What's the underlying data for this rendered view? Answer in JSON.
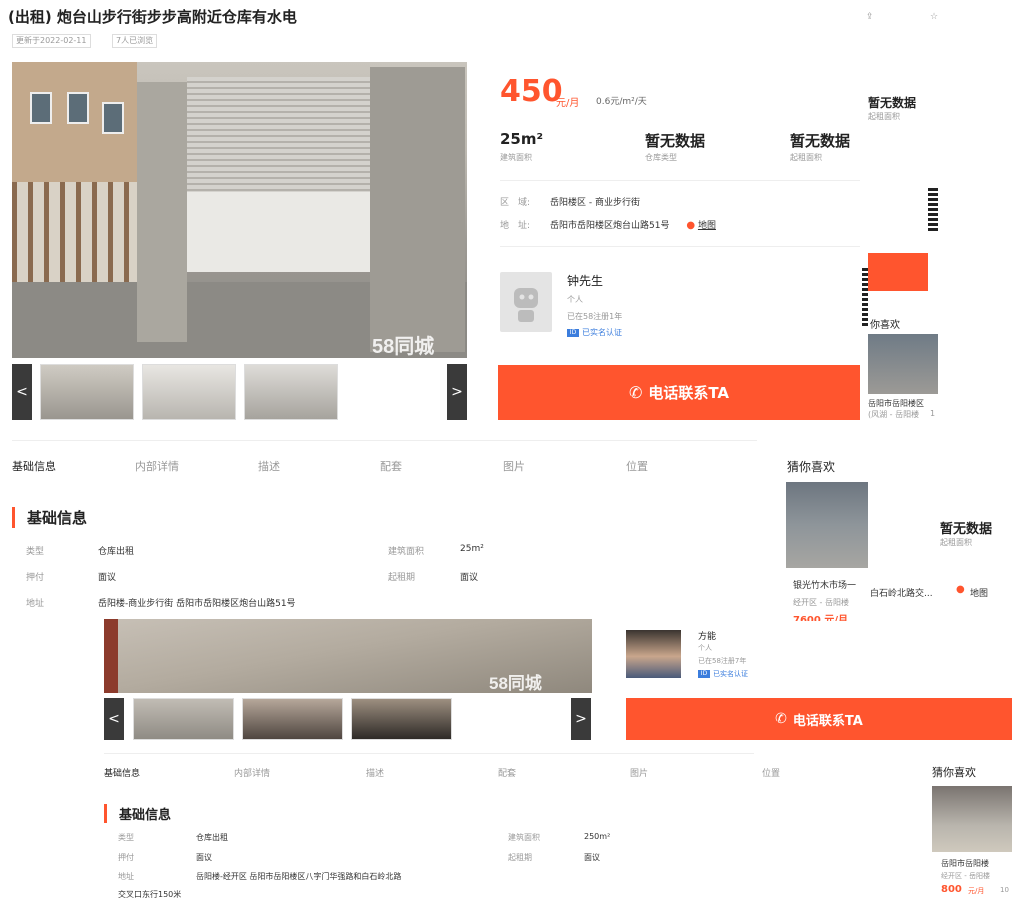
{
  "header": {
    "title": "(出租) 炮台山步行街步步高附近仓库有水电",
    "updated": "更新于2022-02-11",
    "views": "7人已浏览"
  },
  "gallery": {
    "watermark": "58同城",
    "prev": "<",
    "next": ">"
  },
  "price": {
    "amount": "450",
    "unit": "元/月",
    "per_sqm": "0.6元/m²/天"
  },
  "facts": [
    {
      "value": "25m²",
      "label": "建筑面积"
    },
    {
      "value": "暂无数据",
      "label": "仓库类型"
    },
    {
      "value": "暂无数据",
      "label": "起租面积"
    }
  ],
  "location": {
    "region_label": "区　域:",
    "region_value": "岳阳楼区 - 商业步行街",
    "address_label": "地　址:",
    "address_value": "岳阳市岳阳楼区炮台山路51号",
    "map": "地图"
  },
  "contact": {
    "name": "钟先生",
    "type": "个人",
    "registered": "已在58注册1年",
    "verified": "已实名认证",
    "call": "电话联系TA"
  },
  "tabs": [
    "基础信息",
    "内部详情",
    "描述",
    "配套",
    "图片",
    "位置"
  ],
  "basic": {
    "section": "基础信息",
    "rows": [
      {
        "k": "类型",
        "v": "仓库出租",
        "k2": "建筑面积",
        "v2": "25m²"
      },
      {
        "k": "押付",
        "v": "面议",
        "k2": "起租期",
        "v2": "面议"
      },
      {
        "k": "地址",
        "v": "岳阳楼-商业步行街 岳阳市岳阳楼区炮台山路51号"
      }
    ]
  },
  "guess": {
    "title": "猜你喜欢",
    "item_title": "银光竹木市场一",
    "item_sub": "经开区 - 岳阳楼",
    "item_price": "7600 元/月",
    "item2_title": "岳阳市岳阳楼",
    "item2_sub": "经开区 - 岳阳楼",
    "item2_price": "800",
    "item2_unit": "元/月",
    "item2_extra": "10",
    "side_title": "岳阳市岳阳楼区",
    "side_sub": "(风湖 - 岳阳楼",
    "side_tail": "1"
  },
  "overlap_fragments": {
    "none_data_a": "暂无数据",
    "none_label_a": "起租面积",
    "none_data_b": "暂无数据",
    "none_label_b": "起租面积",
    "addr_tail": "白石岭北路交...",
    "map": "地图",
    "guess_title_fragment": "你喜欢"
  },
  "listing2": {
    "name": "方能",
    "type": "个人",
    "registered": "已在58注册7年",
    "verified": "已实名认证",
    "call": "电话联系TA",
    "tabs": [
      "基础信息",
      "内部详情",
      "描述",
      "配套",
      "图片",
      "位置"
    ],
    "guess": "猜你喜欢",
    "section": "基础信息",
    "rows": [
      {
        "k": "类型",
        "v": "仓库出租",
        "k2": "建筑面积",
        "v2": "250m²"
      },
      {
        "k": "押付",
        "v": "面议",
        "k2": "起租期",
        "v2": "面议"
      },
      {
        "k": "地址",
        "v": "岳阳楼-经开区 岳阳市岳阳楼区八字门华强路和白石岭北路"
      }
    ],
    "addr_cont": "交叉口东行150米"
  },
  "colors": {
    "accent": "#ff552e",
    "verify": "#3b7ddd"
  }
}
